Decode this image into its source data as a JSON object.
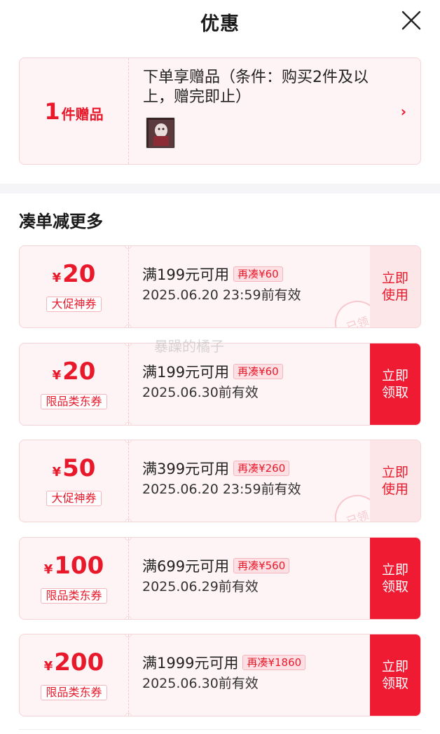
{
  "header": {
    "title": "优惠"
  },
  "gift": {
    "count": "1",
    "unit": "件赠品",
    "description": "下单享赠品（条件：购买2件及以上，赠完即止）"
  },
  "section": {
    "title": "凑单减更多"
  },
  "watermark": "暴躁的橘子",
  "coupons": [
    {
      "yen": "¥",
      "value": "20",
      "tag": "大促神券",
      "condition": "满199元可用",
      "extra": "再凑¥60",
      "valid": "2025.06.20 23:59前有效",
      "action": "立即使用",
      "action_type": "use",
      "stamp": "已领"
    },
    {
      "yen": "¥",
      "value": "20",
      "tag": "限品类东券",
      "condition": "满199元可用",
      "extra": "再凑¥60",
      "valid": "2025.06.30前有效",
      "action": "立即领取",
      "action_type": "claim"
    },
    {
      "yen": "¥",
      "value": "50",
      "tag": "大促神券",
      "condition": "满399元可用",
      "extra": "再凑¥260",
      "valid": "2025.06.20 23:59前有效",
      "action": "立即使用",
      "action_type": "use",
      "stamp": "已领"
    },
    {
      "yen": "¥",
      "value": "100",
      "tag": "限品类东券",
      "condition": "满699元可用",
      "extra": "再凑¥560",
      "valid": "2025.06.29前有效",
      "action": "立即领取",
      "action_type": "claim"
    },
    {
      "yen": "¥",
      "value": "200",
      "tag": "限品类东券",
      "condition": "满1999元可用",
      "extra": "再凑¥1860",
      "valid": "2025.06.30前有效",
      "action": "立即领取",
      "action_type": "claim"
    }
  ],
  "colors": {
    "accent": "#e8192b",
    "claim_bg": "#ef1b33",
    "card_bg": "#fff4f5"
  }
}
